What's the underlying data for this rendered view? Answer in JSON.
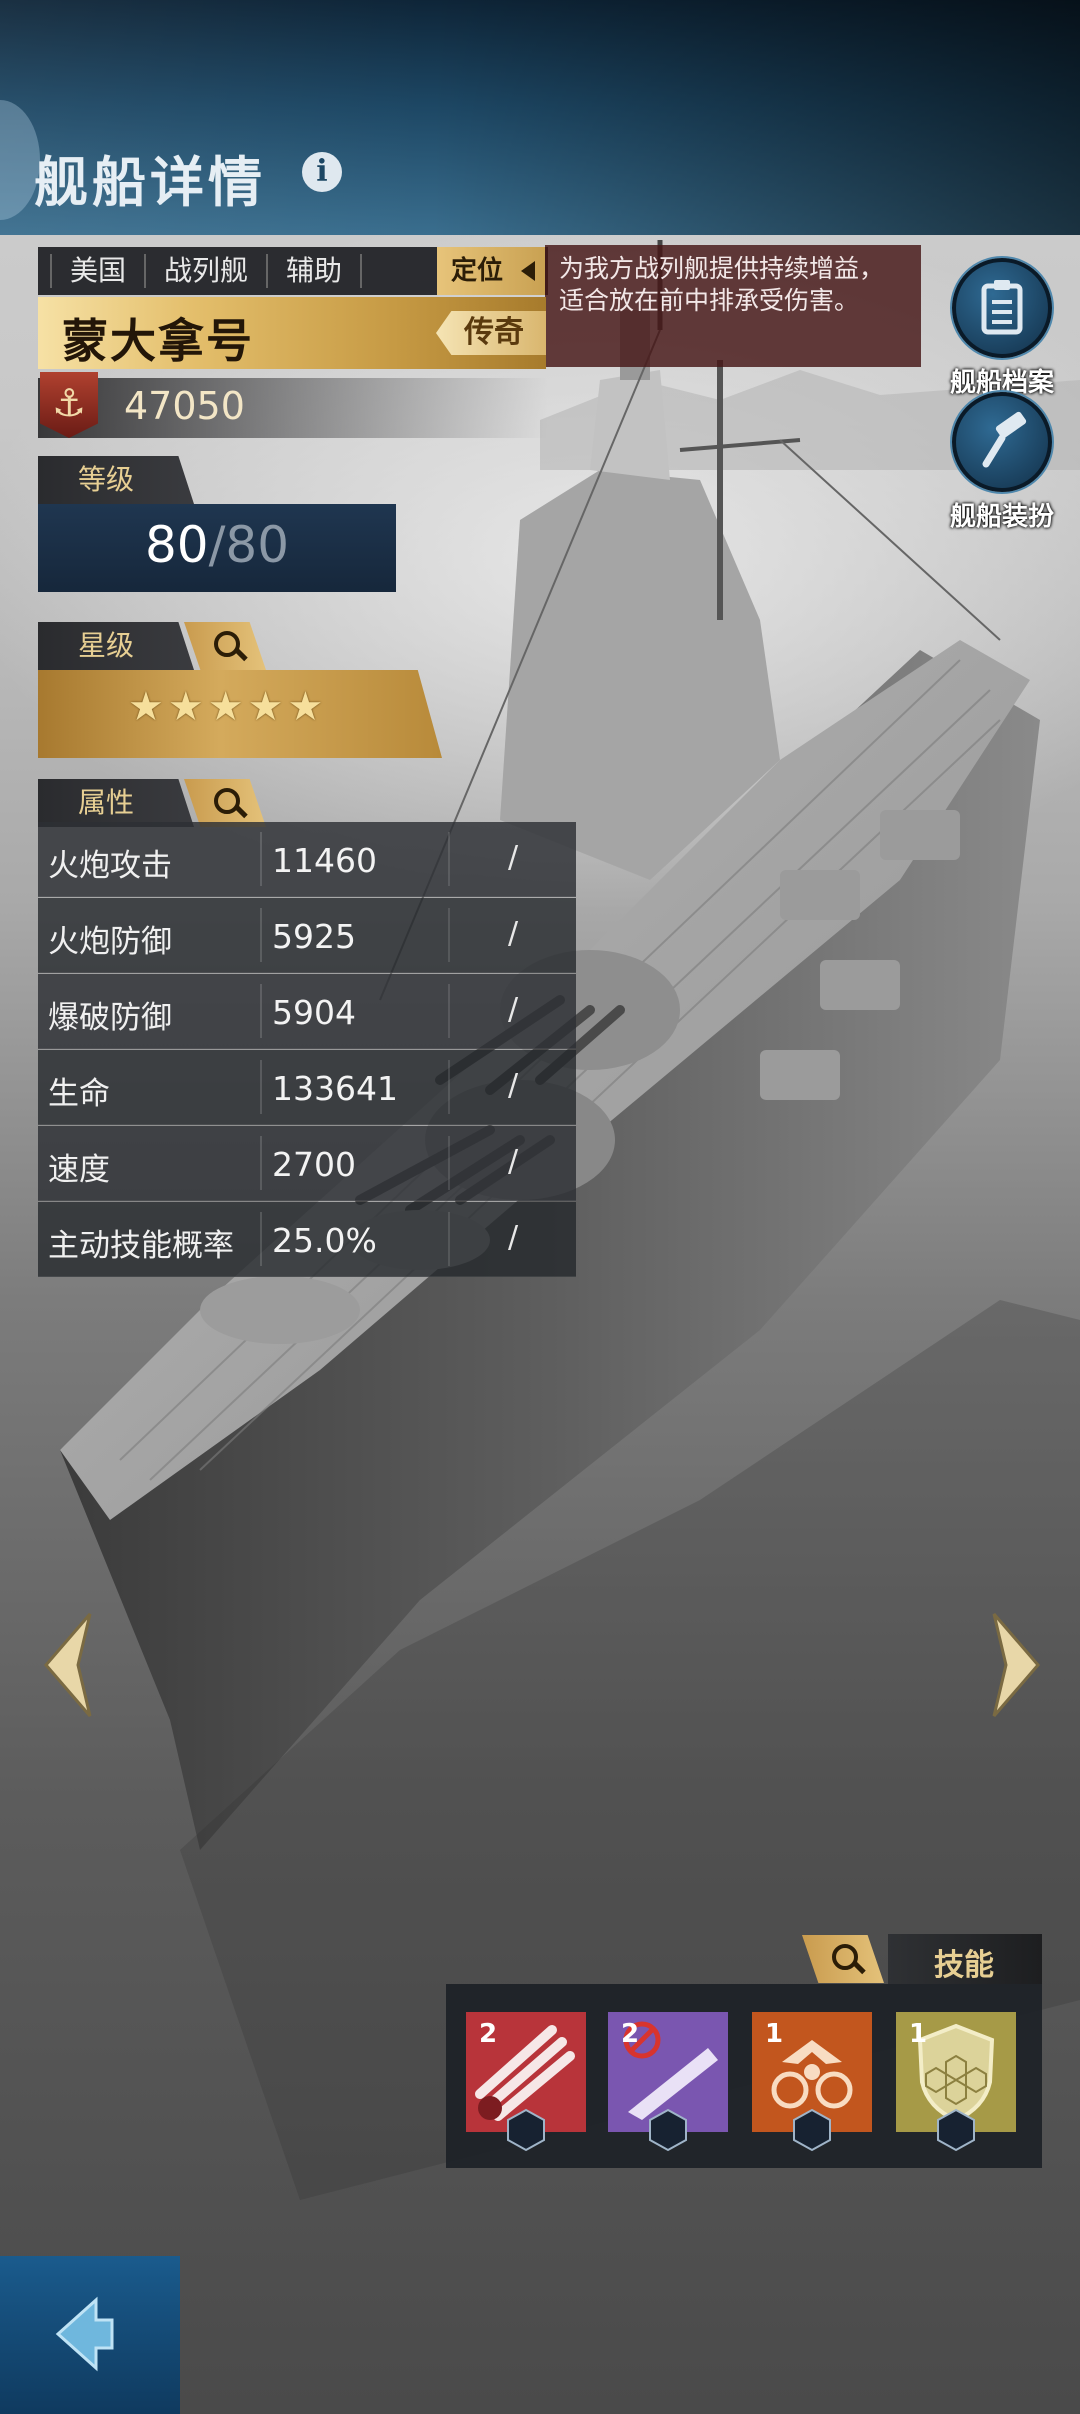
{
  "header": {
    "title": "舰船详情",
    "info_icon": "info-icon"
  },
  "ship": {
    "tags": [
      "美国",
      "战列舰",
      "辅助"
    ],
    "positioning_label": "定位",
    "description": "为我方战列舰提供持续增益，适合放在前中排承受伤害。",
    "name": "蒙大拿号",
    "rarity": "传奇",
    "power": "47050"
  },
  "level": {
    "label": "等级",
    "current": "80",
    "max": "/80"
  },
  "stars": {
    "label": "星级",
    "count": 5,
    "display": "★★★★★"
  },
  "attributes": {
    "label": "属性",
    "rows": [
      {
        "name": "火炮攻击",
        "value": "11460",
        "bonus": "/"
      },
      {
        "name": "火炮防御",
        "value": "5925",
        "bonus": "/"
      },
      {
        "name": "爆破防御",
        "value": "5904",
        "bonus": "/"
      },
      {
        "name": "生命",
        "value": "133641",
        "bonus": "/"
      },
      {
        "name": "速度",
        "value": "2700",
        "bonus": "/"
      },
      {
        "name": "主动技能概率",
        "value": "25.0%",
        "bonus": "/"
      }
    ]
  },
  "side_buttons": {
    "archive": "舰船档案",
    "skins": "舰船装扮"
  },
  "skills": {
    "label": "技能",
    "items": [
      {
        "icon": "triple-cannon-icon",
        "level": "2",
        "color": "#b8343a"
      },
      {
        "icon": "no-aircraft-ship-icon",
        "level": "2",
        "color": "#7a56b0"
      },
      {
        "icon": "eagle-emblem-icon",
        "level": "1",
        "color": "#c2561e"
      },
      {
        "icon": "shield-icon",
        "level": "1",
        "color": "#a69a47"
      }
    ]
  },
  "colors": {
    "gold": "#d4aa5c",
    "navy": "#1d4764",
    "desc_bg": "#46161a"
  }
}
